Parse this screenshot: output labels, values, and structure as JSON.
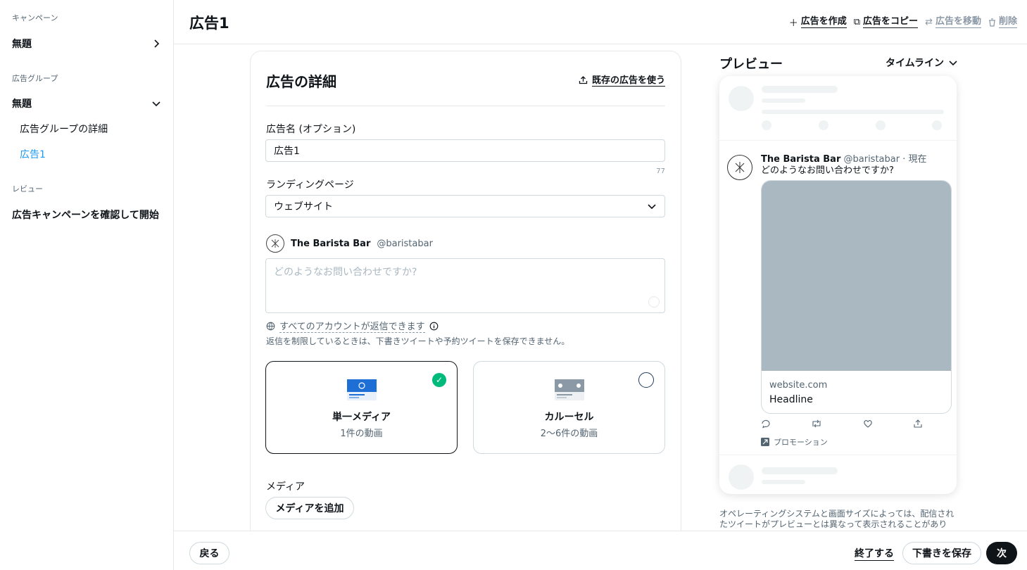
{
  "sidebar": {
    "campaign_section": "キャンペーン",
    "campaign_item": "無題",
    "adgroup_section": "広告グループ",
    "adgroup_item": "無題",
    "adgroup_details": "広告グループの詳細",
    "ad_item": "広告1",
    "review_section": "レビュー",
    "review_item": "広告キャンペーンを確認して開始"
  },
  "header": {
    "title": "広告1",
    "create_ad": "広告を作成",
    "copy_ad": "広告をコピー",
    "move_ad": "広告を移動",
    "delete": "削除"
  },
  "card": {
    "title": "広告の詳細",
    "use_existing": "既存の広告を使う",
    "ad_name_label": "広告名 (オプション)",
    "ad_name_value": "広告1",
    "char_count": "77",
    "landing_label": "ランディングページ",
    "landing_value": "ウェブサイト",
    "account_name": "The Barista Bar",
    "account_handle": "@baristabar",
    "tweet_placeholder": "どのようなお問い合わせですか?",
    "reply_setting": "すべてのアカウントが返信できます",
    "reply_note": "返信を制限しているときは、下書きツイートや予約ツイートを保存できません。",
    "formats": [
      {
        "title": "単一メディア",
        "subtitle": "1件の動画",
        "selected": true
      },
      {
        "title": "カルーセル",
        "subtitle": "2〜6件の動画",
        "selected": false
      }
    ],
    "media_label": "メディア",
    "add_media": "メディアを追加"
  },
  "preview": {
    "title": "プレビュー",
    "view": "タイムライン",
    "name": "The Barista Bar",
    "handle_time": "@baristabar · 現在",
    "text": "どのようなお問い合わせですか?",
    "domain": "website.com",
    "headline": "Headline",
    "promo": "プロモーション",
    "note": "オペレーティングシステムと画面サイズによっては、配信されたツイートがプレビューとは異なって表示されることがありま"
  },
  "footer": {
    "back": "戻る",
    "finish": "終了する",
    "save_draft": "下書きを保存",
    "next": "次"
  },
  "colors": {
    "accent": "#1d9bf0",
    "check": "#00ba7c",
    "media_placeholder": "#aab8c2"
  }
}
